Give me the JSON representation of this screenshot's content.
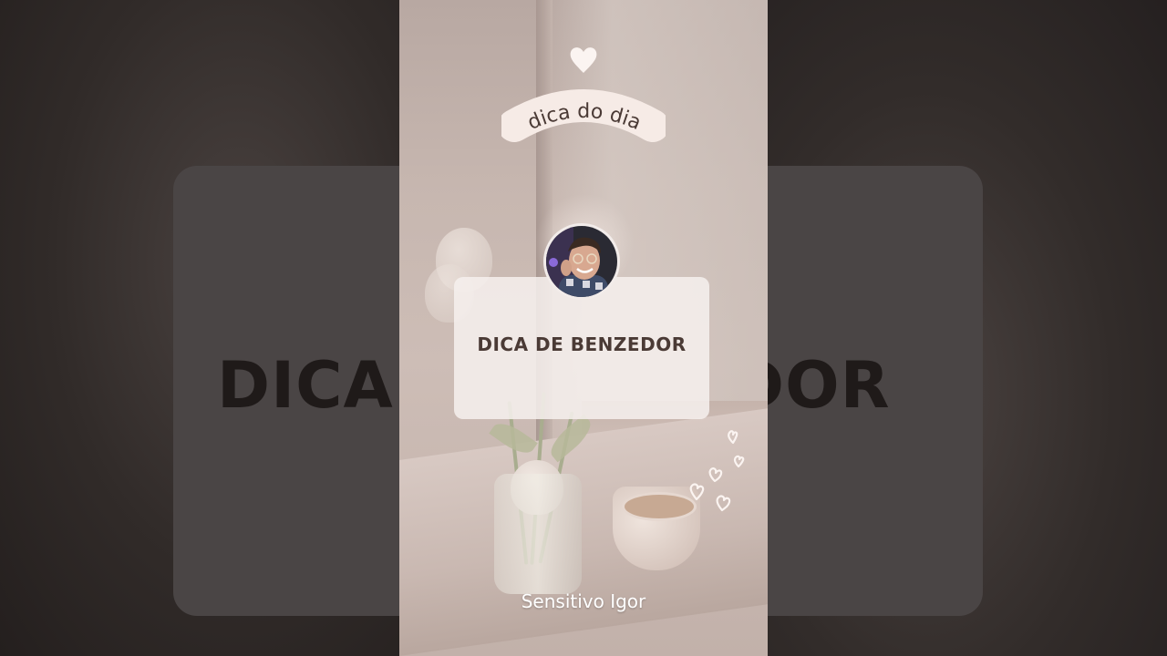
{
  "background": {
    "side_text_left": "DICA",
    "side_text_right": "DOR"
  },
  "badge": {
    "label": "dica do dia"
  },
  "card": {
    "title": "DICA DE BENZEDOR"
  },
  "footer": {
    "author": "Sensitivo Igor"
  },
  "icons": {
    "top": "heart-icon",
    "cluster": "hearts-cluster-icon",
    "avatar": "profile-avatar"
  },
  "colors": {
    "card_text": "#4a3a35",
    "pill_bg": "#f6ebe6",
    "pill_text": "#4a3a35",
    "author_text": "#ffffff"
  }
}
